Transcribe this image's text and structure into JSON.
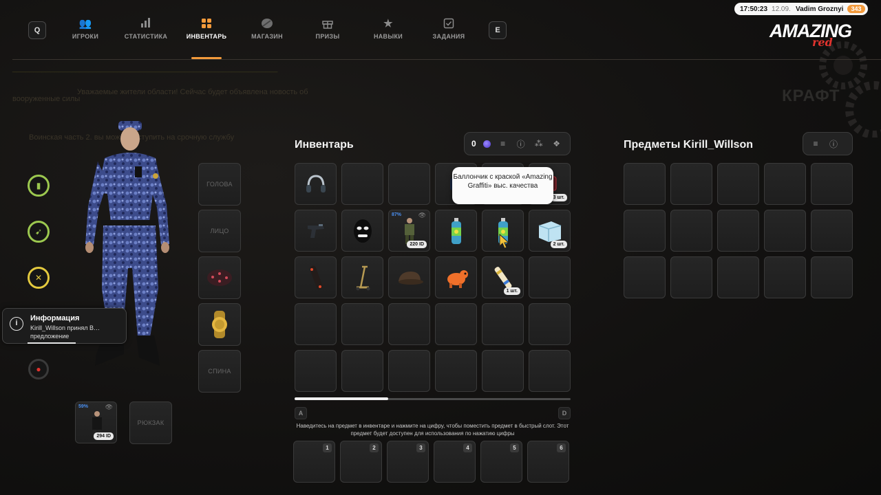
{
  "topbar": {
    "search_key": "Q",
    "edit_key": "E",
    "tabs": [
      {
        "label": "ИГРОКИ",
        "icon": "players-icon"
      },
      {
        "label": "СТАТИСТИКА",
        "icon": "stats-icon"
      },
      {
        "label": "ИНВЕНТАРЬ",
        "icon": "inventory-icon"
      },
      {
        "label": "МАГАЗИН",
        "icon": "shop-icon"
      },
      {
        "label": "ПРИЗЫ",
        "icon": "gift-icon"
      },
      {
        "label": "НАВЫКИ",
        "icon": "star-icon"
      },
      {
        "label": "ЗАДАНИЯ",
        "icon": "task-icon"
      }
    ],
    "active_tab": "ИНВЕНТАРЬ",
    "accent_color": "#f39a3b"
  },
  "status": {
    "time": "17:50:23",
    "date": "12.09.2026",
    "username": "Vadim Groznyi",
    "level": "343"
  },
  "logo": {
    "main": "AMAZING",
    "sub": "red"
  },
  "background_text": {
    "craft": "КРАФТ",
    "line1": "Уважаемые жители области! Сейчас будет объявлена новость об",
    "line2": "вооруженные силы",
    "line3": "Воинская часть 2. вы можете вступить на срочную службу"
  },
  "character": {
    "equip_slots": [
      "ГОЛОВА",
      "ЛИЦО",
      "",
      "",
      "СПИНА"
    ],
    "skin_slot": {
      "percent": "59%",
      "id": "294 ID"
    },
    "backpack_label": "РЮКЗАК"
  },
  "notification": {
    "title": "Информация",
    "message": "Kirill_Willson принял В… предложение"
  },
  "inventory": {
    "title": "Инвентарь",
    "coins": "0",
    "tooltip": "Баллончик с краской «Amazing Graffiti» выс. качества",
    "slots": [
      {
        "item": "headphones",
        "badge": ""
      },
      {
        "item": "",
        "badge": ""
      },
      {
        "item": "",
        "badge": ""
      },
      {
        "item": "dark-item",
        "badge": ""
      },
      {
        "item": "",
        "badge": ""
      },
      {
        "item": "red-item",
        "badge": "3 шт."
      },
      {
        "item": "pistol",
        "badge": ""
      },
      {
        "item": "balaclava",
        "badge": ""
      },
      {
        "item": "soldier-skin",
        "badge": "220 ID",
        "percent": "87%"
      },
      {
        "item": "spray-can",
        "badge": ""
      },
      {
        "item": "spray-can",
        "badge": ""
      },
      {
        "item": "box",
        "badge": "2 шт."
      },
      {
        "item": "skateboard",
        "badge": ""
      },
      {
        "item": "scooter",
        "badge": ""
      },
      {
        "item": "cap",
        "badge": ""
      },
      {
        "item": "toy-dog",
        "badge": ""
      },
      {
        "item": "firework",
        "badge": "1 шт."
      }
    ],
    "page_left": "A",
    "page_right": "D",
    "hint": "Наведитесь на предмет в инвентаре и нажмите на цифру, чтобы поместить предмет в быстрый слот. Этот предмет будет доступен для использования по нажатию цифры",
    "quick_slots": [
      "1",
      "2",
      "3",
      "4",
      "5",
      "6"
    ]
  },
  "other_panel": {
    "title": "Предметы Kirill_Willson"
  }
}
